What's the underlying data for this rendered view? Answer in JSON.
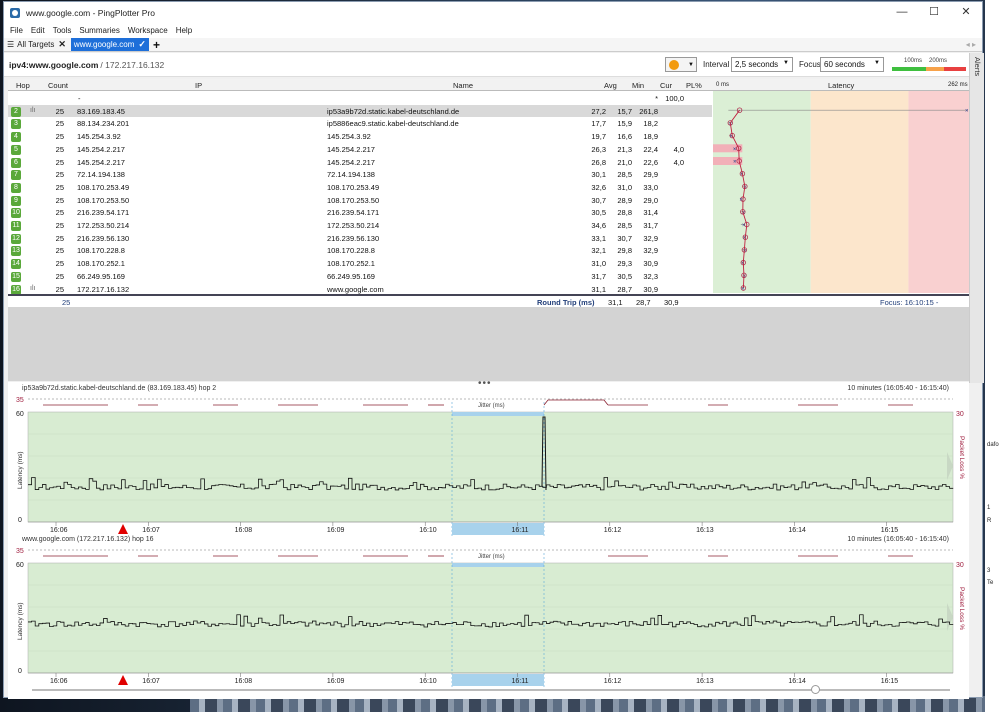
{
  "window": {
    "title": "www.google.com - PingPlotter Pro",
    "minimize": "—",
    "maximize": "☐",
    "close": "✕"
  },
  "menu": [
    "File",
    "Edit",
    "Tools",
    "Summaries",
    "Workspace",
    "Help"
  ],
  "tabs": {
    "all_targets": "All Targets",
    "active": "www.google.com",
    "add": "+",
    "nav": "◂ ▸"
  },
  "toolbar": {
    "target": "ipv4:www.google.com",
    "ip": "/ 172.217.16.132",
    "interval_label": "Interval",
    "interval_value": "2,5 seconds",
    "focus_label": "Focus",
    "focus_value": "60 seconds",
    "scale_100": "100ms",
    "scale_200": "200ms"
  },
  "alerts": "Alerts",
  "columns": {
    "hop": "Hop",
    "count": "Count",
    "ip": "IP",
    "name": "Name",
    "avg": "Avg",
    "min": "Min",
    "cur": "Cur",
    "pl": "PL%",
    "latency_min": "0 ms",
    "latency": "Latency",
    "latency_max": "262 ms"
  },
  "rows": [
    {
      "hop": "",
      "count": "",
      "ip": "-",
      "name": "",
      "avg": "",
      "min": "",
      "cur": "*",
      "pl": "100,0"
    },
    {
      "hop": "2",
      "count": "25",
      "ip": "83.169.183.45",
      "name": "ip53a9b72d.static.kabel-deutschland.de",
      "avg": "27,2",
      "min": "15,7",
      "cur": "261,8",
      "pl": ""
    },
    {
      "hop": "3",
      "count": "25",
      "ip": "88.134.234.201",
      "name": "ip5886eac9.static.kabel-deutschland.de",
      "avg": "17,7",
      "min": "15,9",
      "cur": "18,2",
      "pl": ""
    },
    {
      "hop": "4",
      "count": "25",
      "ip": "145.254.3.92",
      "name": "145.254.3.92",
      "avg": "19,7",
      "min": "16,6",
      "cur": "18,9",
      "pl": ""
    },
    {
      "hop": "5",
      "count": "25",
      "ip": "145.254.2.217",
      "name": "145.254.2.217",
      "avg": "26,3",
      "min": "21,3",
      "cur": "22,4",
      "pl": "4,0"
    },
    {
      "hop": "6",
      "count": "25",
      "ip": "145.254.2.217",
      "name": "145.254.2.217",
      "avg": "26,8",
      "min": "21,0",
      "cur": "22,6",
      "pl": "4,0"
    },
    {
      "hop": "7",
      "count": "25",
      "ip": "72.14.194.138",
      "name": "72.14.194.138",
      "avg": "30,1",
      "min": "28,5",
      "cur": "29,9",
      "pl": ""
    },
    {
      "hop": "8",
      "count": "25",
      "ip": "108.170.253.49",
      "name": "108.170.253.49",
      "avg": "32,6",
      "min": "31,0",
      "cur": "33,0",
      "pl": ""
    },
    {
      "hop": "9",
      "count": "25",
      "ip": "108.170.253.50",
      "name": "108.170.253.50",
      "avg": "30,7",
      "min": "28,9",
      "cur": "29,0",
      "pl": ""
    },
    {
      "hop": "10",
      "count": "25",
      "ip": "216.239.54.171",
      "name": "216.239.54.171",
      "avg": "30,5",
      "min": "28,8",
      "cur": "31,4",
      "pl": ""
    },
    {
      "hop": "11",
      "count": "25",
      "ip": "172.253.50.214",
      "name": "172.253.50.214",
      "avg": "34,6",
      "min": "28,5",
      "cur": "31,7",
      "pl": ""
    },
    {
      "hop": "12",
      "count": "25",
      "ip": "216.239.56.130",
      "name": "216.239.56.130",
      "avg": "33,1",
      "min": "30,7",
      "cur": "32,9",
      "pl": ""
    },
    {
      "hop": "13",
      "count": "25",
      "ip": "108.170.228.8",
      "name": "108.170.228.8",
      "avg": "32,1",
      "min": "29,8",
      "cur": "32,9",
      "pl": ""
    },
    {
      "hop": "14",
      "count": "25",
      "ip": "108.170.252.1",
      "name": "108.170.252.1",
      "avg": "31,0",
      "min": "29,3",
      "cur": "30,9",
      "pl": ""
    },
    {
      "hop": "15",
      "count": "25",
      "ip": "66.249.95.169",
      "name": "66.249.95.169",
      "avg": "31,7",
      "min": "30,5",
      "cur": "32,3",
      "pl": ""
    },
    {
      "hop": "16",
      "count": "25",
      "ip": "172.217.16.132",
      "name": "www.google.com",
      "avg": "31,1",
      "min": "28,7",
      "cur": "30,9",
      "pl": ""
    }
  ],
  "summary": {
    "count": "25",
    "label": "Round Trip (ms)",
    "avg": "31,1",
    "min": "28,7",
    "cur": "30,9",
    "focus": "Focus: 16:10:15 - 16:11:15"
  },
  "graph1": {
    "title": "ip53a9b72d.static.kabel-deutschland.de (83.169.183.45) hop 2",
    "range": "10 minutes (16:05:40 - 16:15:40)",
    "jitter_label": "Jitter (ms)",
    "y_top": "60",
    "y_bottom": "0",
    "pl_top": "30",
    "jitter_max": "35",
    "ylabel": "Latency (ms)",
    "pl_label": "Packet Loss %"
  },
  "graph2": {
    "title": "www.google.com (172.217.16.132) hop 16",
    "range": "10 minutes (16:05:40 - 16:15:40)",
    "jitter_label": "Jitter (ms)",
    "y_top": "60",
    "y_bottom": "0",
    "pl_top": "30",
    "jitter_max": "35",
    "ylabel": "Latency (ms)",
    "pl_label": "Packet Loss %"
  },
  "time_ticks": [
    "16:06",
    "16:07",
    "16:08",
    "16:09",
    "16:10",
    "16:11",
    "16:12",
    "16:13",
    "16:14",
    "16:15"
  ],
  "desktop_right": [
    "dafo",
    "1",
    "R",
    "3",
    "Te"
  ],
  "colors": {
    "good": "#dbefd5",
    "warn": "#fce6cc",
    "bad": "#f9d0d0",
    "hop": "#5aa83a",
    "line": "#c02040",
    "focus": "#a8d2ec"
  }
}
